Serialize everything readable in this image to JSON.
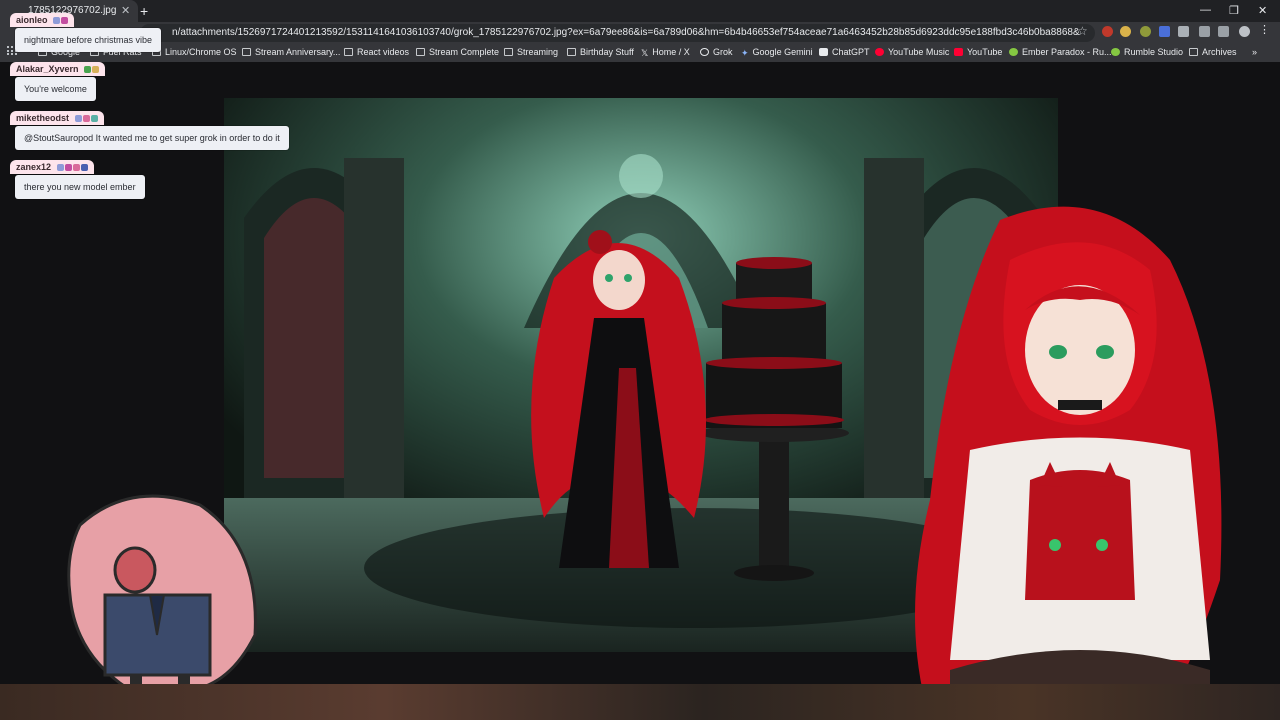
{
  "browser": {
    "tab_title": "1785122976702.jpg",
    "url": "n/attachments/1526971724401213592/1531141641036103740/grok_1785122976702.jpg?ex=6a79ee86&is=6a789d06&hm=6b4b46653ef754aceae71a6463452b28b85d6923ddc95e188fbd3c46b0ba8868&",
    "bookmarks": [
      {
        "label": "Google",
        "icon": "google-icon"
      },
      {
        "label": "Fuel Rats",
        "icon": "folder-icon"
      },
      {
        "label": "Linux/Chrome OS",
        "icon": "folder-icon"
      },
      {
        "label": "Stream Anniversary...",
        "icon": "folder-icon"
      },
      {
        "label": "React videos",
        "icon": "folder-icon"
      },
      {
        "label": "Stream Complete",
        "icon": "folder-icon"
      },
      {
        "label": "Streaming",
        "icon": "folder-icon"
      },
      {
        "label": "Birthday Stuff",
        "icon": "folder-icon"
      },
      {
        "label": "Home / X",
        "icon": "x-icon"
      },
      {
        "label": "Grok",
        "icon": "grok-icon"
      },
      {
        "label": "Google Gemini",
        "icon": "gemini-icon"
      },
      {
        "label": "ChatGPT",
        "icon": "chatgpt-icon"
      },
      {
        "label": "YouTube Music",
        "icon": "youtube-music-icon"
      },
      {
        "label": "YouTube",
        "icon": "youtube-icon"
      },
      {
        "label": "Ember Paradox - Ru...",
        "icon": "rumble-icon"
      },
      {
        "label": "Rumble Studio",
        "icon": "rumble-icon"
      },
      {
        "label": "Archives",
        "icon": "folder-icon"
      }
    ]
  },
  "chat": [
    {
      "user": "aionleo",
      "message": "nightmare before christmas vibe"
    },
    {
      "user": "Alakar_Xyvern",
      "message": "You're welcome"
    },
    {
      "user": "miketheodst",
      "message": "@StoutSauropod It wanted me to get super grok in order to do it"
    },
    {
      "user": "zanex12",
      "message": "there you new model ember"
    }
  ],
  "colors": {
    "hair_red": "#d4101e",
    "stained_glass": "#6fb8a1",
    "chat_name_bg": "#fde4ec",
    "chat_bubble_bg": "#eef0f5"
  }
}
